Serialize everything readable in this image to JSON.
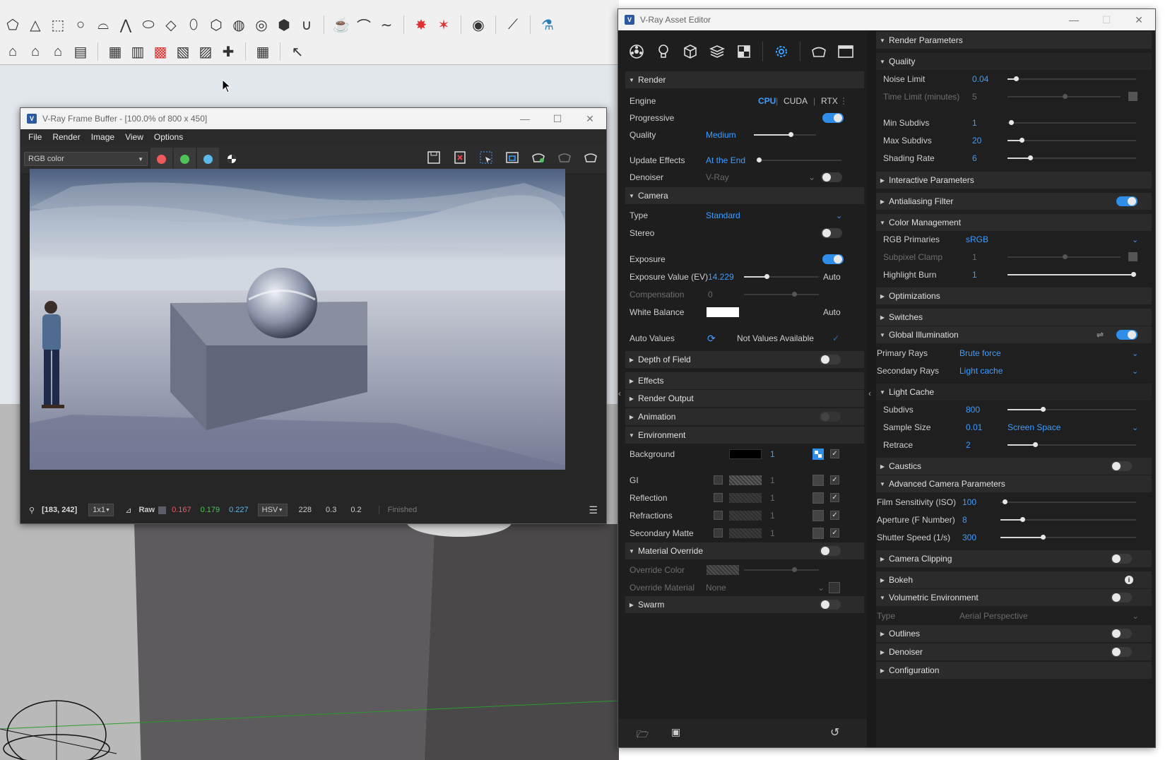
{
  "sketchup": {
    "toolbar_row1_icons": [
      "pencil-poly-icon",
      "pyramid-icon",
      "box-icon",
      "circle-icon",
      "cylinder-icon",
      "cone-icon",
      "ellipse-icon",
      "plane-icon",
      "torus-icon",
      "dodecahedron-icon",
      "sphere-icon",
      "geodesic-icon",
      "hull-icon",
      "magnet-icon",
      "teapot-icon",
      "teapot-lid-icon",
      "rope-icon",
      "explode-icon",
      "star-icon",
      "globe-icon",
      "brush-icon",
      "potion-icon"
    ],
    "toolbar_row2_icons": [
      "house-icon",
      "house-roof-icon",
      "house-outline-icon",
      "bench-icon",
      "sheet-icon",
      "sheet-lines-icon",
      "grid-red-icon",
      "grid-arrow-icon",
      "grid-square-icon",
      "grid-cross-icon",
      "rainbow-icon",
      "cursor-icon"
    ]
  },
  "vfb": {
    "title": "V-Ray Frame Buffer - [100.0% of 800 x 450]",
    "menu": [
      "File",
      "Render",
      "Image",
      "View",
      "Options"
    ],
    "channel": "RGB color",
    "status": {
      "coords": "[183, 242]",
      "sampling": "1x1",
      "mode": "Raw",
      "r": "0.167",
      "g": "0.179",
      "b": "0.227",
      "color_space": "HSV",
      "h": "228",
      "s": "0.3",
      "v": "0.2",
      "state": "Finished"
    }
  },
  "ae": {
    "title": "V-Ray Asset Editor",
    "accent": "#3d9dff",
    "left": {
      "render": "Render",
      "engine": "Engine",
      "engine_opts": [
        "CPU",
        "CUDA",
        "RTX"
      ],
      "progressive": "Progressive",
      "quality": "Quality",
      "quality_val": "Medium",
      "update_effects": "Update Effects",
      "update_effects_val": "At the End",
      "denoiser": "Denoiser",
      "denoiser_val": "V-Ray",
      "camera": "Camera",
      "type": "Type",
      "type_val": "Standard",
      "stereo": "Stereo",
      "exposure": "Exposure",
      "ev": "Exposure Value (EV)",
      "ev_val": "14.229",
      "auto": "Auto",
      "compensation": "Compensation",
      "compensation_val": "0",
      "white_balance": "White Balance",
      "auto_values": "Auto Values",
      "not_available": "Not Values Available",
      "dof": "Depth of Field",
      "effects": "Effects",
      "render_output": "Render Output",
      "animation": "Animation",
      "environment": "Environment",
      "background": "Background",
      "gi": "GI",
      "reflection": "Reflection",
      "refractions": "Refractions",
      "secondary_matte": "Secondary Matte",
      "one": "1",
      "material_override": "Material Override",
      "override_color": "Override Color",
      "override_material": "Override Material",
      "none": "None",
      "swarm": "Swarm"
    },
    "right": {
      "render_parameters": "Render Parameters",
      "quality": "Quality",
      "noise_limit": "Noise Limit",
      "noise_limit_val": "0.04",
      "time_limit": "Time Limit (minutes)",
      "time_limit_val": "5",
      "min_subdivs": "Min Subdivs",
      "min_subdivs_val": "1",
      "max_subdivs": "Max Subdivs",
      "max_subdivs_val": "20",
      "shading_rate": "Shading Rate",
      "shading_rate_val": "6",
      "interactive": "Interactive Parameters",
      "aa_filter": "Antialiasing Filter",
      "color_mgmt": "Color Management",
      "rgb_primaries": "RGB Primaries",
      "rgb_primaries_val": "sRGB",
      "subpixel_clamp": "Subpixel Clamp",
      "subpixel_clamp_val": "1",
      "highlight_burn": "Highlight Burn",
      "highlight_burn_val": "1",
      "optimizations": "Optimizations",
      "switches": "Switches",
      "gi": "Global Illumination",
      "primary_rays": "Primary Rays",
      "primary_rays_val": "Brute force",
      "secondary_rays": "Secondary Rays",
      "secondary_rays_val": "Light cache",
      "light_cache": "Light Cache",
      "subdivs": "Subdivs",
      "subdivs_val": "800",
      "sample_size": "Sample Size",
      "sample_size_val": "0.01",
      "screen_space": "Screen Space",
      "retrace": "Retrace",
      "retrace_val": "2",
      "caustics": "Caustics",
      "adv_camera": "Advanced Camera Parameters",
      "iso": "Film Sensitivity (ISO)",
      "iso_val": "100",
      "fnumber": "Aperture (F Number)",
      "fnumber_val": "8",
      "shutter": "Shutter Speed (1/s)",
      "shutter_val": "300",
      "camera_clipping": "Camera Clipping",
      "bokeh": "Bokeh",
      "vol_env": "Volumetric Environment",
      "type": "Type",
      "type_val": "Aerial Perspective",
      "outlines": "Outlines",
      "denoiser": "Denoiser",
      "configuration": "Configuration"
    }
  }
}
